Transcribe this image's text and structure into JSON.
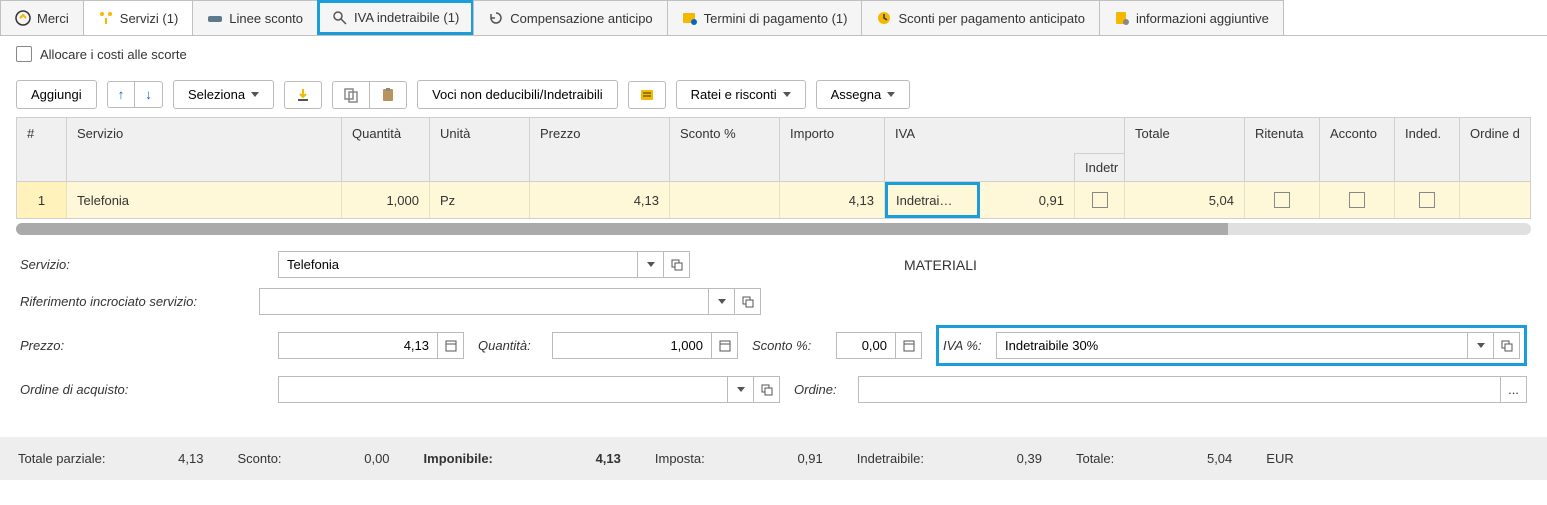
{
  "tabs": {
    "merci": "Merci",
    "servizi": "Servizi (1)",
    "linee": "Linee sconto",
    "iva": "IVA indetraibile (1)",
    "comp": "Compensazione anticipo",
    "termini": "Termini di pagamento (1)",
    "sconti": "Sconti per pagamento anticipato",
    "info": "informazioni aggiuntive"
  },
  "allocate": "Allocare i costi alle scorte",
  "toolbar": {
    "aggiungi": "Aggiungi",
    "seleziona": "Seleziona",
    "voci": "Voci non deducibili/Indetraibili",
    "ratei": "Ratei e risconti",
    "assegna": "Assegna"
  },
  "headers": {
    "num": "#",
    "servizio": "Servizio",
    "quantita": "Quantità",
    "unita": "Unità",
    "prezzo": "Prezzo",
    "sconto": "Sconto %",
    "importo": "Importo",
    "iva": "IVA",
    "indetr": "Indetr",
    "totale": "Totale",
    "ritenuta": "Ritenuta",
    "acconto": "Acconto",
    "indeb": "Inded.",
    "ordine": "Ordine d"
  },
  "row": {
    "num": "1",
    "servizio": "Telefonia",
    "quantita": "1,000",
    "unita": "Pz",
    "prezzo": "4,13",
    "sconto": "",
    "importo": "4,13",
    "iva": "Indetrai…",
    "iva2": "0,91",
    "totale": "5,04"
  },
  "form": {
    "servizio_lbl": "Servizio:",
    "servizio_val": "Telefonia",
    "materiali": "MATERIALI",
    "rif_lbl": "Riferimento incrociato servizio:",
    "prezzo_lbl": "Prezzo:",
    "prezzo_val": "4,13",
    "quantita_lbl": "Quantità:",
    "quantita_val": "1,000",
    "sconto_lbl": "Sconto %:",
    "sconto_val": "0,00",
    "iva_lbl": "IVA %:",
    "iva_val": "Indetraibile 30%",
    "ordine_lbl": "Ordine di acquisto:",
    "ordine2_lbl": "Ordine:"
  },
  "totals": {
    "parziale_lbl": "Totale parziale:",
    "parziale_val": "4,13",
    "sconto_lbl": "Sconto:",
    "sconto_val": "0,00",
    "imponibile_lbl": "Imponibile:",
    "imponibile_val": "4,13",
    "imposta_lbl": "Imposta:",
    "imposta_val": "0,91",
    "indetraibile_lbl": "Indetraibile:",
    "indetraibile_val": "0,39",
    "totale_lbl": "Totale:",
    "totale_val": "5,04",
    "currency": "EUR"
  }
}
